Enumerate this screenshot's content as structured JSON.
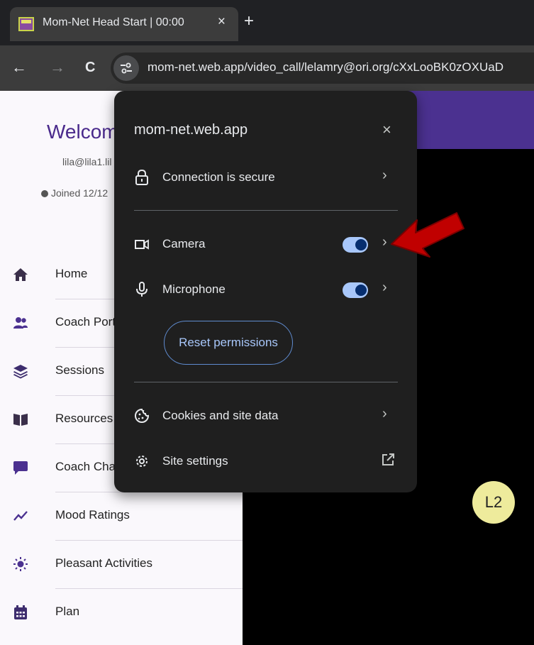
{
  "browser": {
    "tab": {
      "title": "Mom-Net Head Start | 00:00",
      "close": "×"
    },
    "new_tab": "+",
    "toolbar": {
      "back": "←",
      "forward": "→",
      "reload": "C"
    },
    "url": "mom-net.web.app/video_call/lelamry@ori.org/cXxLooBK0zOXUaD"
  },
  "sidebar": {
    "welcome": "Welcom",
    "email": "lila@lila1.lil",
    "joined": "Joined 12/12",
    "items": [
      {
        "label": "Home",
        "icon": "home-icon"
      },
      {
        "label": "Coach Port",
        "icon": "users-icon"
      },
      {
        "label": "Sessions",
        "icon": "layers-icon"
      },
      {
        "label": "Resources",
        "icon": "book-icon"
      },
      {
        "label": "Coach Cha",
        "icon": "chat-icon"
      },
      {
        "label": "Mood Ratings",
        "icon": "chart-line-icon"
      },
      {
        "label": "Pleasant Activities",
        "icon": "sun-icon"
      },
      {
        "label": "Plan",
        "icon": "calendar-icon"
      }
    ]
  },
  "video": {
    "participant_initials": "L2"
  },
  "popup": {
    "domain": "mom-net.web.app",
    "close": "×",
    "connection": "Connection is secure",
    "permissions": [
      {
        "label": "Camera",
        "enabled": true
      },
      {
        "label": "Microphone",
        "enabled": true
      }
    ],
    "reset_button": "Reset permissions",
    "cookies": "Cookies and site data",
    "site_settings": "Site settings",
    "chevron": "›"
  },
  "colors": {
    "brand_purple": "#4b3190",
    "toggle_track": "#a8c7fa",
    "toggle_thumb": "#062e6f",
    "annotation_arrow": "#c00000"
  }
}
